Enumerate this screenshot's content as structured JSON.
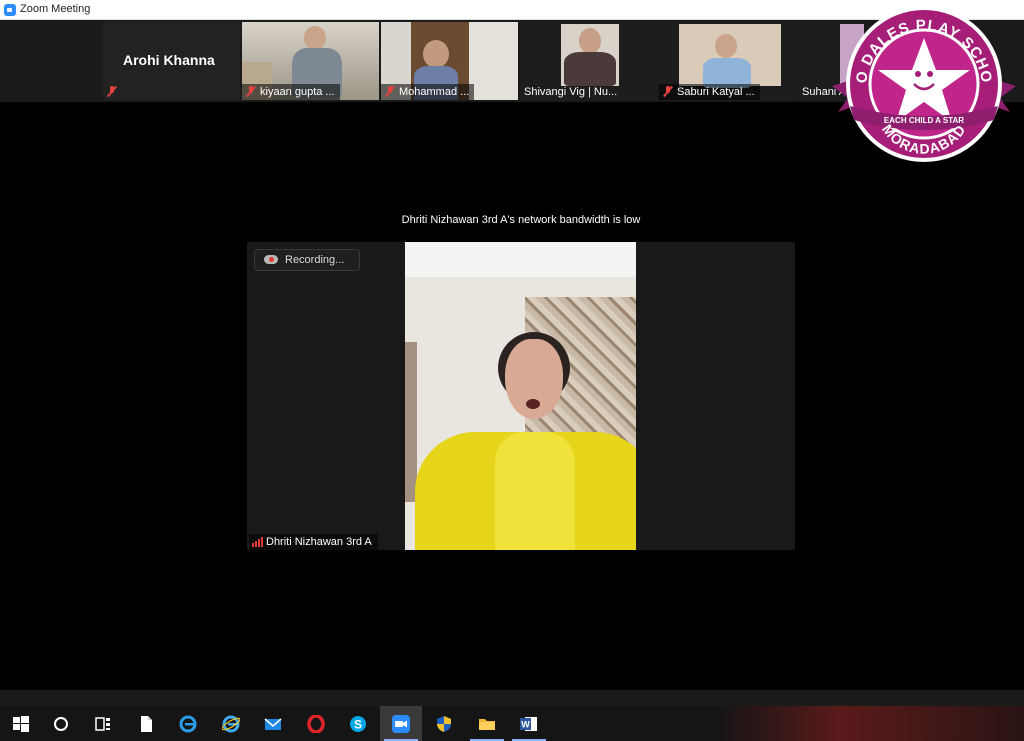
{
  "window": {
    "title": "Zoom Meeting"
  },
  "participants": [
    {
      "name": "Arohi Khanna",
      "muted": true
    },
    {
      "name": "kiyaan gupta ...",
      "muted": true
    },
    {
      "name": "Mohammad ...",
      "muted": true
    },
    {
      "name": "Shivangi Vig | Nu...",
      "muted": false
    },
    {
      "name": "Saburi Katyal ...",
      "muted": true
    },
    {
      "name": "Suhani A...",
      "muted": false
    }
  ],
  "notice": "Dhriti Nizhawan 3rd A's network bandwidth is low",
  "main_video": {
    "recording_label": "Recording...",
    "speaker_name": "Dhriti Nizhawan 3rd A"
  },
  "logo": {
    "text_top": "NEO DALES PLAY SCHOOL",
    "text_ribbon": "EACH CHILD A STAR",
    "text_bottom": "MORADABAD"
  },
  "taskbar": {
    "items": [
      "windows-start",
      "cortana-search",
      "task-view",
      "file",
      "edge",
      "internet-explorer",
      "mail",
      "opera",
      "skype",
      "zoom",
      "security",
      "file-explorer",
      "word"
    ]
  }
}
